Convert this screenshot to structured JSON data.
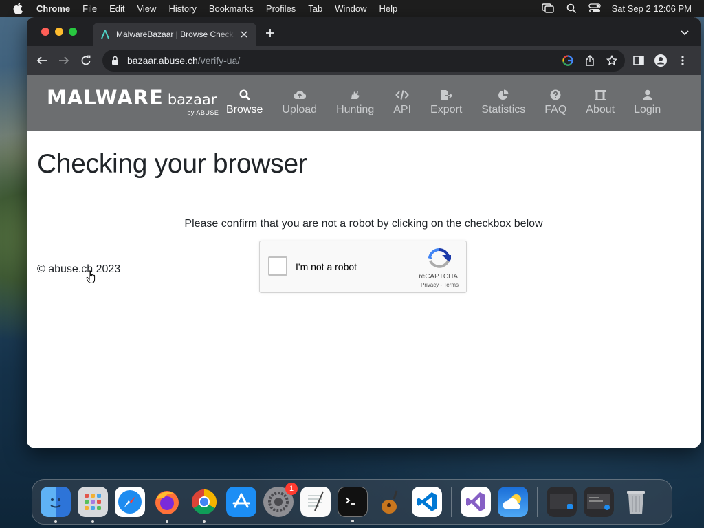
{
  "menubar": {
    "app_name": "Chrome",
    "items": [
      "File",
      "Edit",
      "View",
      "History",
      "Bookmarks",
      "Profiles",
      "Tab",
      "Window",
      "Help"
    ],
    "datetime": "Sat Sep 2  12:06 PM"
  },
  "browser": {
    "tab_title": "MalwareBazaar | Browse Check",
    "url_host": "bazaar.abuse.ch",
    "url_path": "/verify-ua/"
  },
  "site": {
    "brand_main": "MALWARE",
    "brand_sub": "bazaar",
    "brand_by": "by ABUSE",
    "nav": [
      {
        "label": "Browse",
        "icon": "search-icon",
        "active": true
      },
      {
        "label": "Upload",
        "icon": "cloud-upload-icon"
      },
      {
        "label": "Hunting",
        "icon": "hunting-icon"
      },
      {
        "label": "API",
        "icon": "code-icon"
      },
      {
        "label": "Export",
        "icon": "export-icon"
      },
      {
        "label": "Statistics",
        "icon": "pie-chart-icon"
      },
      {
        "label": "FAQ",
        "icon": "question-icon"
      },
      {
        "label": "About",
        "icon": "building-icon"
      },
      {
        "label": "Login",
        "icon": "user-icon"
      }
    ]
  },
  "content": {
    "title": "Checking your browser",
    "notice": "Please confirm that you are not a robot by clicking on the checkbox below",
    "recaptcha": {
      "label": "I'm not a robot",
      "brand": "reCAPTCHA",
      "links": "Privacy - Terms"
    },
    "footer": "© abuse.ch 2023"
  },
  "dock": {
    "apps": [
      "Finder",
      "Launchpad",
      "Safari",
      "Firefox",
      "Chrome",
      "App Store",
      "System Settings",
      "TextEdit",
      "Terminal",
      "GarageBand",
      "VS Code",
      "Visual Studio",
      "Weather"
    ],
    "settings_badge": "1"
  },
  "colors": {
    "nav_bg": "#6c6e70",
    "chrome_dark": "#202124",
    "chrome_toolbar": "#35363a"
  }
}
